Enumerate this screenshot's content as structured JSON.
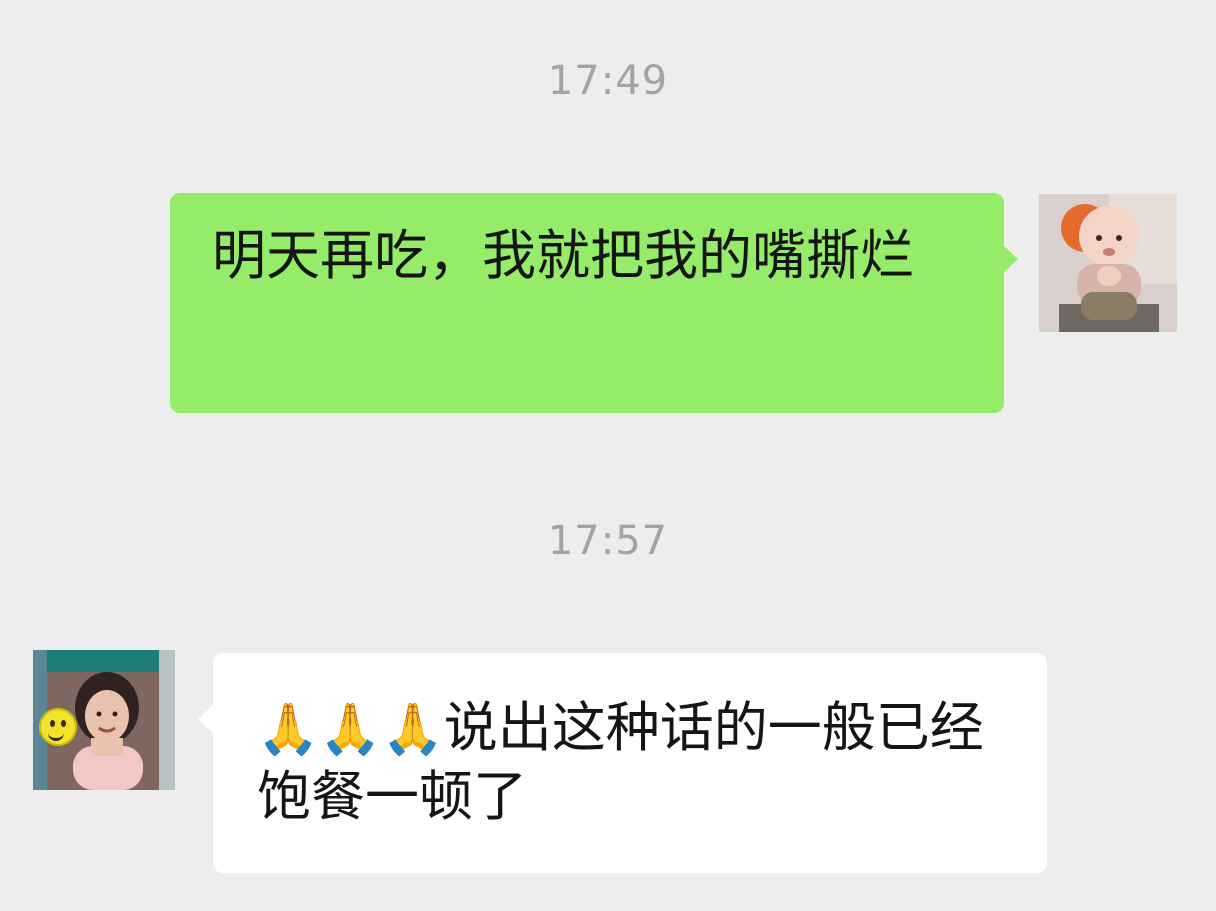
{
  "messages": [
    {
      "type": "time",
      "text": "17:49"
    },
    {
      "type": "message",
      "side": "right",
      "text": "明天再吃，我就把我的嘴撕烂",
      "avatar": "baby-avatar"
    },
    {
      "type": "time",
      "text": "17:57"
    },
    {
      "type": "message",
      "side": "left",
      "emoji": "🙏🙏🙏",
      "text": "说出这种话的一般已经饱餐一顿了",
      "avatar": "woman-avatar"
    }
  ],
  "colors": {
    "background": "#ededed",
    "outgoing_bubble": "#95ec69",
    "incoming_bubble": "#ffffff",
    "timestamp": "#a3a3a3"
  }
}
